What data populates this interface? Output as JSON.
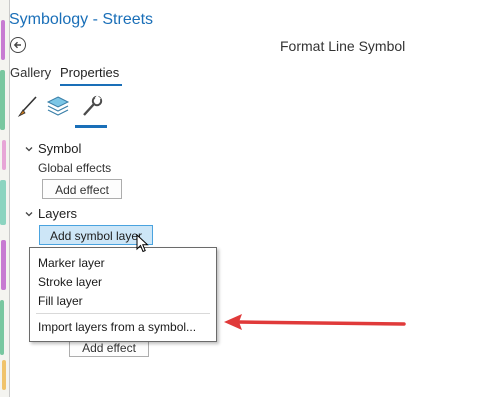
{
  "pane": {
    "title": "Symbology - Streets",
    "subtitle": "Format Line Symbol"
  },
  "tabs": [
    {
      "label": "Gallery",
      "active": false
    },
    {
      "label": "Properties",
      "active": true
    }
  ],
  "icon_tabs": [
    {
      "icon": "brush-icon",
      "active": false
    },
    {
      "icon": "layers-icon",
      "active": false
    },
    {
      "icon": "wrench-icon",
      "active": true
    }
  ],
  "symbol_section": {
    "header": "Symbol",
    "global_effects_label": "Global effects",
    "add_effect_label": "Add effect"
  },
  "layers_section": {
    "header": "Layers",
    "add_symbol_layer_label": "Add symbol layer",
    "add_effect_label": "Add effect"
  },
  "dropdown": {
    "items": [
      "Marker layer",
      "Stroke layer",
      "Fill layer"
    ],
    "import_label": "Import layers from a symbol..."
  },
  "colors": {
    "accent": "#1a6fb8",
    "hover_button": "#cde6f7",
    "annotation_arrow": "#e03a3a"
  }
}
